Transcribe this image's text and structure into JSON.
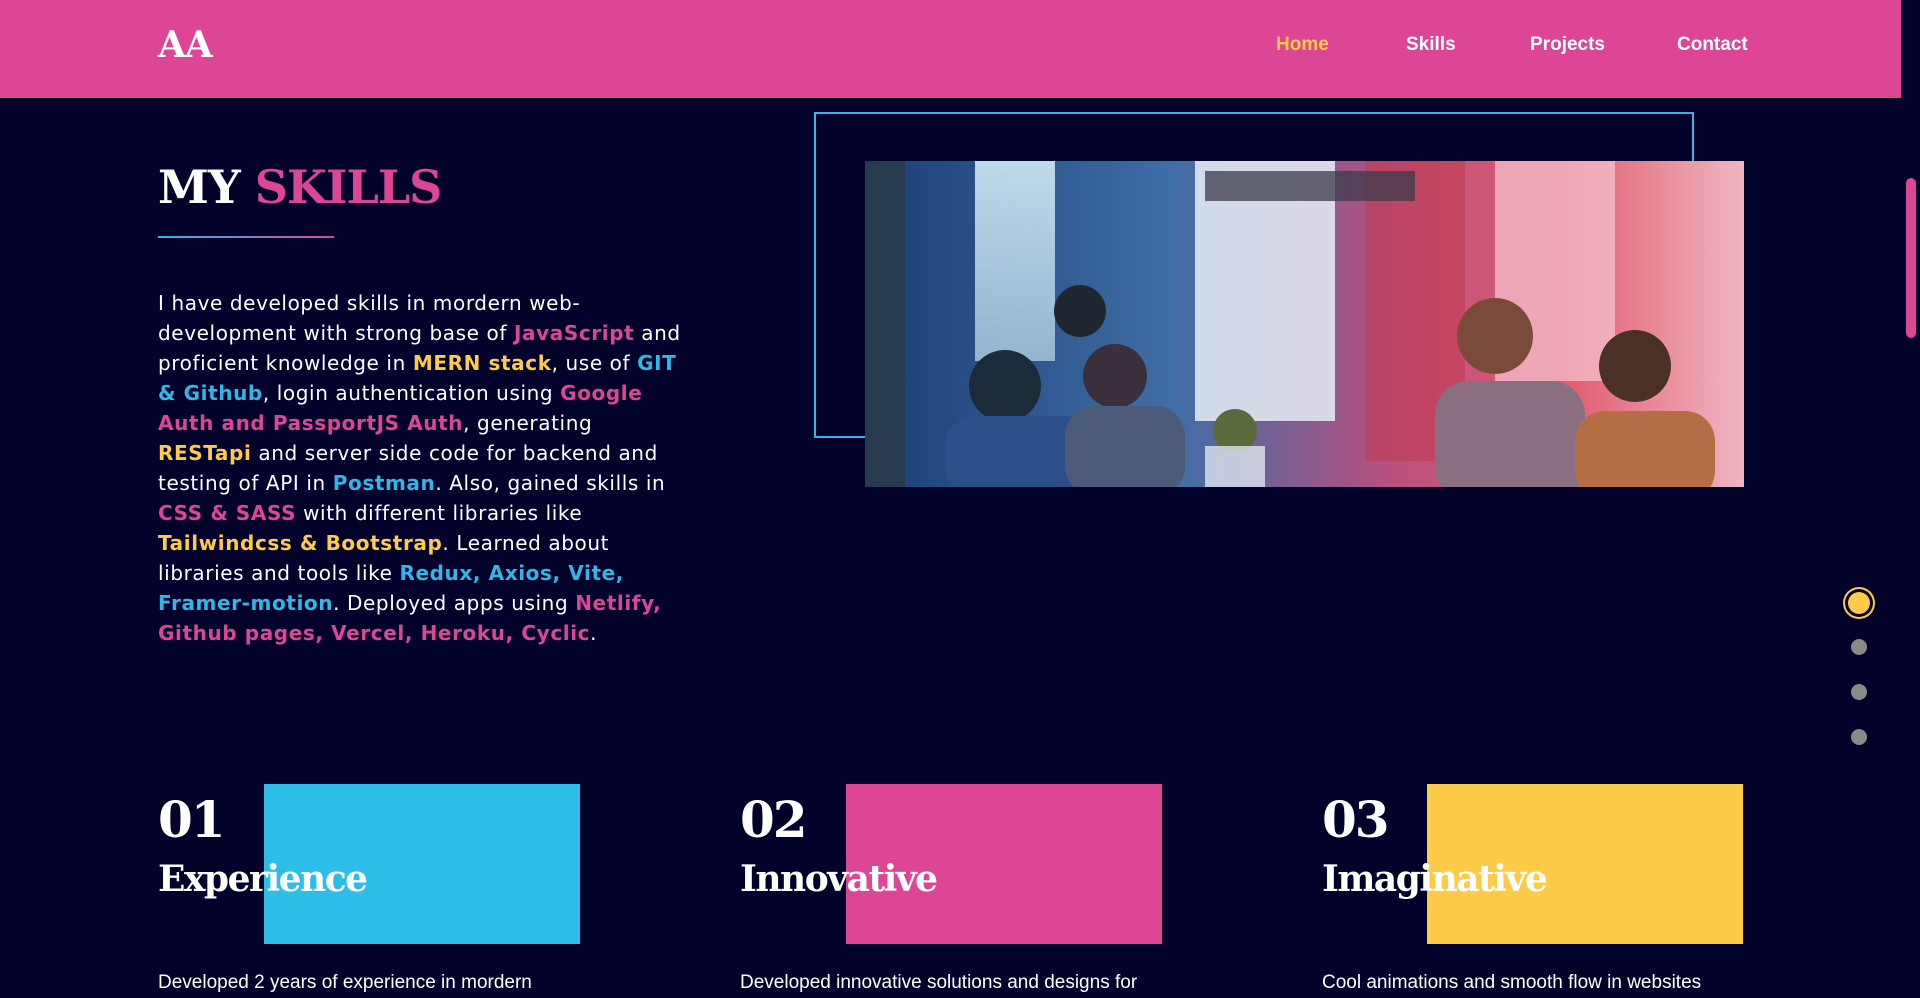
{
  "header": {
    "logo": "AA",
    "nav": [
      "Home",
      "Skills",
      "Projects",
      "Contact"
    ],
    "active": "Home"
  },
  "skills": {
    "title_white": "MY",
    "title_pink": "SKILLS",
    "paragraph": [
      {
        "text": "I have developed skills in mordern web-development with strong base of ",
        "style": "plain"
      },
      {
        "text": "JavaScript",
        "style": "pink"
      },
      {
        "text": " and proficient knowledge in ",
        "style": "plain"
      },
      {
        "text": "MERN stack",
        "style": "yellow"
      },
      {
        "text": ", use of ",
        "style": "plain"
      },
      {
        "text": "GIT & Github",
        "style": "blue"
      },
      {
        "text": ", login authentication using ",
        "style": "plain"
      },
      {
        "text": "Google Auth and PassportJS Auth",
        "style": "pink"
      },
      {
        "text": ", generating ",
        "style": "plain"
      },
      {
        "text": "RESTapi",
        "style": "yellow"
      },
      {
        "text": " and server side code for backend and testing of API in ",
        "style": "plain"
      },
      {
        "text": "Postman",
        "style": "blue"
      },
      {
        "text": ". Also, gained skills in ",
        "style": "plain"
      },
      {
        "text": "CSS & SASS",
        "style": "pink"
      },
      {
        "text": " with different libraries like ",
        "style": "plain"
      },
      {
        "text": "Tailwindcss & Bootstrap",
        "style": "yellow"
      },
      {
        "text": ". Learned about libraries and tools like ",
        "style": "plain"
      },
      {
        "text": "Redux, Axios, Vite, Framer-motion",
        "style": "blue"
      },
      {
        "text": ". Deployed apps using ",
        "style": "plain"
      },
      {
        "text": "Netlify, Github pages, Vercel, Heroku, Cyclic",
        "style": "pink"
      },
      {
        "text": ".",
        "style": "plain"
      }
    ]
  },
  "cards": [
    {
      "number": "01",
      "title": "Experience",
      "description": "Developed 2 years of experience in mordern",
      "square_color": "#2dbde9"
    },
    {
      "number": "02",
      "title": "Innovative",
      "description": "Developed innovative solutions and designs for",
      "square_color": "#dc4695"
    },
    {
      "number": "03",
      "title": "Imaginative",
      "description": "Cool animations and smooth flow in websites",
      "square_color": "#fdcb47"
    }
  ],
  "section_dots": {
    "count": 4,
    "active_index": 0
  },
  "colors": {
    "background": "#02022a",
    "header": "#dc4695",
    "accent_pink": "#dc4695",
    "accent_yellow": "#fdcb47",
    "accent_blue": "#2fb8e6"
  }
}
